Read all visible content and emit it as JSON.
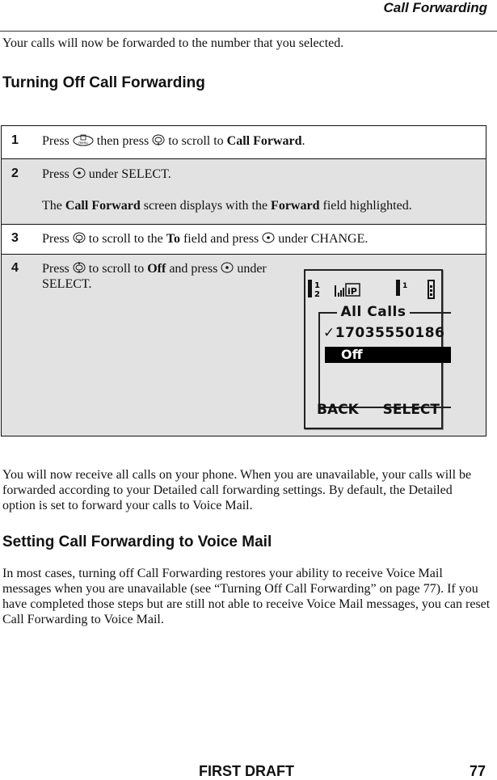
{
  "header": {
    "running_title": "Call Forwarding"
  },
  "intro": "Your calls will now be forwarded to the number that you selected.",
  "section1": {
    "heading": "Turning Off Call Forwarding",
    "steps": [
      {
        "num": "1",
        "p1": "Press",
        "p2": "then press",
        "p3": "to scroll to",
        "bold": "Call Forward",
        "p4": "."
      },
      {
        "num": "2",
        "p1": "Press",
        "p2": "under SELECT.",
        "note_pre": "The",
        "note_b1": "Call Forward",
        "note_mid": "screen displays with the",
        "note_b2": "Forward",
        "note_post": "field highlighted."
      },
      {
        "num": "3",
        "p1": "Press",
        "p2": "to scroll to the",
        "bold": "To",
        "p3": "field and press",
        "p4": "under CHANGE."
      },
      {
        "num": "4",
        "p1": "Press",
        "p2": "to scroll to",
        "bold": "Off",
        "p3": "and press",
        "p4": "under SELECT."
      }
    ],
    "phone_screen": {
      "title": "All Calls",
      "number": "17035550186",
      "selected_item": "Off",
      "left_softkey": "BACK",
      "right_softkey": "SELECT",
      "status_icons": [
        "line-icon",
        "signal-icon",
        "ip-icon",
        "call-icon",
        "battery-icon"
      ]
    }
  },
  "after_text": "You will now receive all calls on your phone. When you are unavailable, your calls will be forwarded according to your Detailed call forwarding settings. By default, the Detailed option is set to forward your calls to Voice Mail.",
  "section2": {
    "heading": "Setting Call Forwarding to Voice Mail",
    "text": "In most cases, turning off Call Forwarding restores your ability to receive Voice Mail messages when you are unavailable (see “Turning Off Call Forwarding” on page 77). If you have completed those steps but are still not able to receive Voice Mail messages, you can reset Call Forwarding to Voice Mail."
  },
  "footer": {
    "draft_label": "FIRST DRAFT",
    "page_number": "77"
  }
}
